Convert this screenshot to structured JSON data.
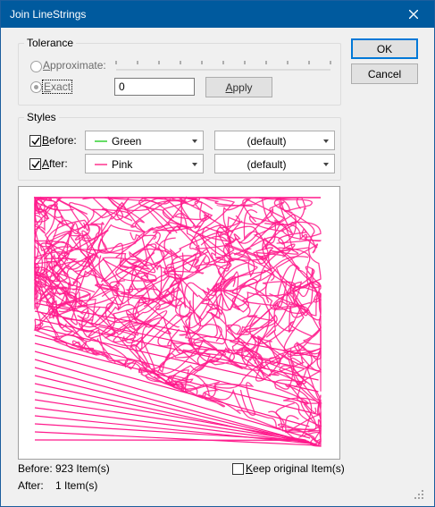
{
  "window": {
    "title": "Join LineStrings"
  },
  "tolerance": {
    "legend": "Tolerance",
    "approximate_label": "Approximate:",
    "exact_label": "Exact",
    "exact_value": "0",
    "apply_label": "Apply"
  },
  "styles": {
    "legend": "Styles",
    "before_label": "Before:",
    "after_label": "After:",
    "before_color": {
      "text": "Green",
      "swatch": "#66dd66"
    },
    "after_color": {
      "text": "Pink",
      "swatch": "#ff66aa"
    },
    "before_width": "(default)",
    "after_width": "(default)"
  },
  "buttons": {
    "ok": "OK",
    "cancel": "Cancel"
  },
  "status": {
    "before_label": "Before:",
    "before_value": "923 Item(s)",
    "after_label": "After:",
    "after_value": "1 Item(s)",
    "keep_original_label": "Keep original Item(s)"
  },
  "preview": {
    "line_color": "#ff1a8c"
  }
}
